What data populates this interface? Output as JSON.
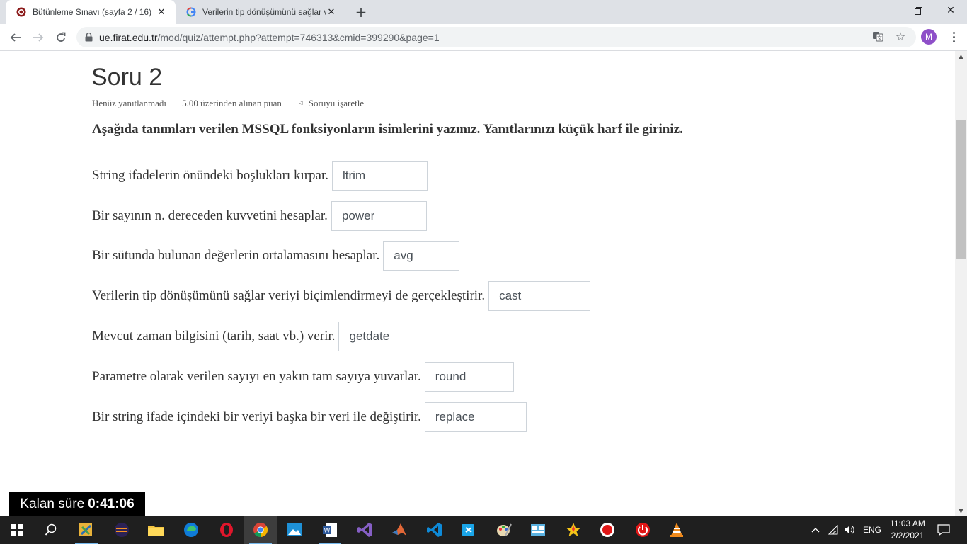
{
  "browser": {
    "tabs": [
      {
        "title": "Bütünleme Sınavı (sayfa 2 / 16)",
        "favicon": "firat-university-icon",
        "active": true
      },
      {
        "title": "Verilerin tip dönüşümünü sağlar veriyi",
        "favicon": "google-icon",
        "active": false
      }
    ],
    "url_host": "ue.firat.edu.tr",
    "url_path": "/mod/quiz/attempt.php?attempt=746313&cmid=399290&page=1",
    "profile_initial": "M"
  },
  "question": {
    "title": "Soru 2",
    "status": "Henüz yanıtlanmadı",
    "points": "5.00 üzerinden alınan puan",
    "flag_label": "Soruyu işaretle",
    "instruction": "Aşağıda tanımları verilen MSSQL fonksiyonların isimlerini yazınız. Yanıtlarınızı küçük harf ile giriniz.",
    "items": [
      {
        "text": "String ifadelerin önündeki boşlukları kırpar.",
        "answer": "ltrim"
      },
      {
        "text": "Bir sayının n. dereceden kuvvetini hesaplar.",
        "answer": "power"
      },
      {
        "text": "Bir sütunda bulunan değerlerin ortalamasını hesaplar.",
        "answer": "avg"
      },
      {
        "text": "Verilerin tip dönüşümünü sağlar veriyi biçimlendirmeyi de gerçekleştirir.",
        "answer": "cast"
      },
      {
        "text": "Mevcut zaman bilgisini (tarih, saat vb.) verir.",
        "answer": "getdate"
      },
      {
        "text": "Parametre olarak verilen sayıyı en yakın tam sayıya yuvarlar.",
        "answer": "round"
      },
      {
        "text": "Bir string ifade içindeki bir veriyi başka bir veri ile değiştirir.",
        "answer": "replace"
      }
    ]
  },
  "timer": {
    "label": "Kalan süre",
    "value": "0:41:06"
  },
  "taskbar": {
    "apps": [
      "start-icon",
      "search-icon",
      "sql-server-icon",
      "eclipse-icon",
      "file-explorer-icon",
      "edge-icon",
      "opera-icon",
      "chrome-icon",
      "photos-icon",
      "word-icon",
      "visual-studio-icon",
      "matlab-icon",
      "vscode-icon",
      "snipping-tool-icon",
      "paint-icon",
      "mysql-workbench-icon",
      "starred-app-icon",
      "recorder-icon",
      "power-icon",
      "vlc-icon"
    ],
    "language": "ENG",
    "time": "11:03 AM",
    "date": "2/2/2021"
  },
  "colors": {
    "accent_purple": "#8e4fc8",
    "timer_bg": "#000000",
    "taskbar_bg": "#1f1f1f"
  }
}
